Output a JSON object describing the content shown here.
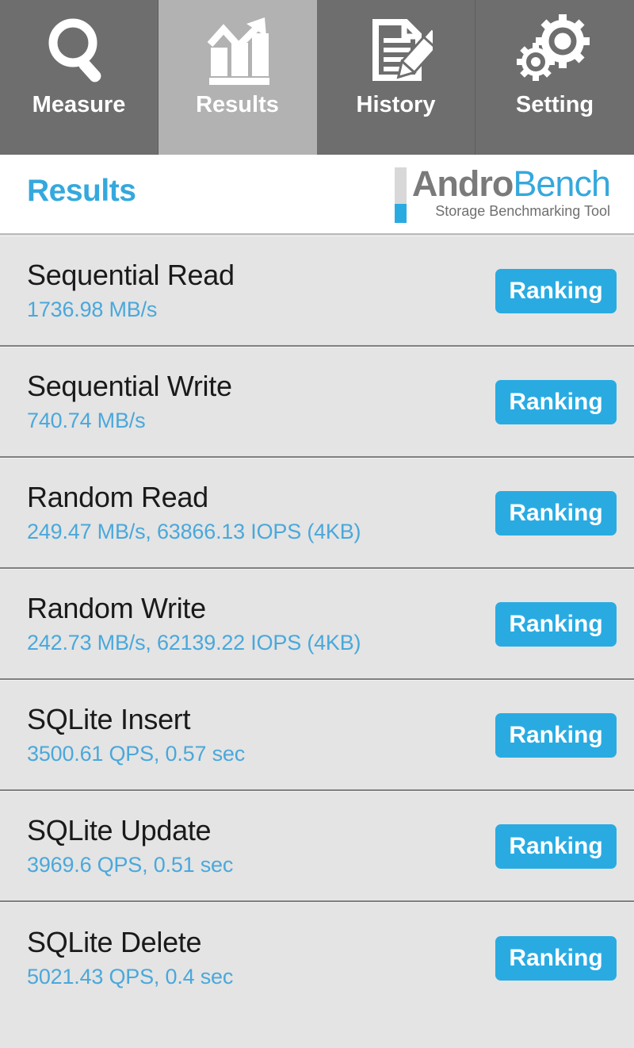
{
  "tabs": [
    {
      "id": "measure",
      "label": "Measure",
      "icon": "magnifier-icon",
      "active": false
    },
    {
      "id": "results",
      "label": "Results",
      "icon": "bar-chart-arrow-icon",
      "active": true
    },
    {
      "id": "history",
      "label": "History",
      "icon": "document-pencil-icon",
      "active": false
    },
    {
      "id": "setting",
      "label": "Setting",
      "icon": "gears-icon",
      "active": false
    }
  ],
  "header": {
    "page_title": "Results",
    "logo_first": "Andro",
    "logo_second": "Bench",
    "logo_tagline": "Storage Benchmarking Tool"
  },
  "colors": {
    "accent_blue": "#29abe2",
    "value_blue": "#4aa8db",
    "tab_inactive": "#6e6e6e",
    "tab_active": "#b2b2b2",
    "row_bg": "#e4e4e4",
    "row_divider": "#808080",
    "logo_gray": "#7a7a7a"
  },
  "results": [
    {
      "title": "Sequential Read",
      "value": "1736.98 MB/s",
      "button": "Ranking"
    },
    {
      "title": "Sequential Write",
      "value": "740.74 MB/s",
      "button": "Ranking"
    },
    {
      "title": "Random Read",
      "value": "249.47 MB/s, 63866.13 IOPS (4KB)",
      "button": "Ranking"
    },
    {
      "title": "Random Write",
      "value": "242.73 MB/s, 62139.22 IOPS (4KB)",
      "button": "Ranking"
    },
    {
      "title": "SQLite Insert",
      "value": "3500.61 QPS, 0.57 sec",
      "button": "Ranking"
    },
    {
      "title": "SQLite Update",
      "value": "3969.6 QPS, 0.51 sec",
      "button": "Ranking"
    },
    {
      "title": "SQLite Delete",
      "value": "5021.43 QPS, 0.4 sec",
      "button": "Ranking"
    }
  ]
}
